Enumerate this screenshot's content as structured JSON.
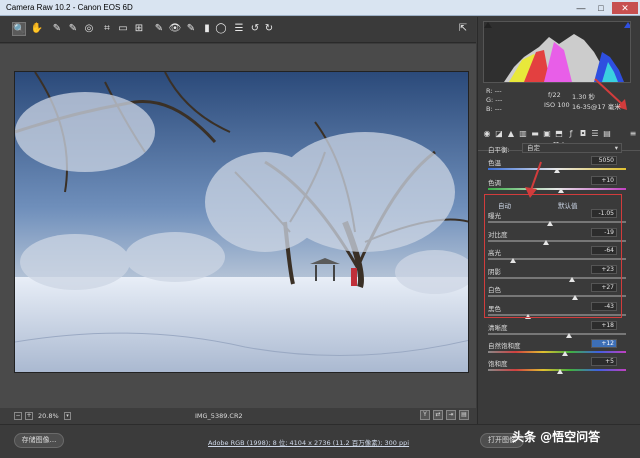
{
  "window": {
    "title": "Camera Raw 10.2  -  Canon EOS 6D",
    "minimize": "—",
    "maximize": "□",
    "close": "✕"
  },
  "photo": {
    "filename": "IMG_5389.CR2",
    "zoom": "20.8%"
  },
  "info": {
    "rgb_r": "R:  ---",
    "rgb_g": "G:  ---",
    "rgb_b": "B:  ---",
    "aperture": "f/22",
    "shutter": "1.30 秒",
    "iso": "ISO 100",
    "lens": "16-35@17 毫米"
  },
  "panel": {
    "title": "基本"
  },
  "white_balance": {
    "label": "白平衡:",
    "value": "自定"
  },
  "sliders_top": [
    {
      "label": "色温",
      "value": "5050",
      "pos": 0.5
    },
    {
      "label": "色调",
      "value": "+10",
      "pos": 0.53
    }
  ],
  "auto_links": {
    "auto": "自动",
    "default": "默认值"
  },
  "sliders_mid": [
    {
      "label": "曝光",
      "value": "-1.05",
      "pos": 0.45
    },
    {
      "label": "对比度",
      "value": "-19",
      "pos": 0.42
    },
    {
      "label": "高光",
      "value": "-64",
      "pos": 0.18
    },
    {
      "label": "阴影",
      "value": "+23",
      "pos": 0.61
    },
    {
      "label": "白色",
      "value": "+27",
      "pos": 0.63
    },
    {
      "label": "黑色",
      "value": "-43",
      "pos": 0.29
    }
  ],
  "sliders_bottom": [
    {
      "label": "清晰度",
      "value": "+18",
      "pos": 0.59
    },
    {
      "label": "自然饱和度",
      "value": "+12",
      "pos": 0.56,
      "highlight": true
    },
    {
      "label": "饱和度",
      "value": "+5",
      "pos": 0.52
    }
  ],
  "footer": {
    "save_button": "存储图像...",
    "workflow": "Adobe RGB (1998); 8 位; 4104 x 2736 (11.2 百万像素); 300 ppi",
    "open_button": "打开图像"
  },
  "watermark": "头条 @悟空问答",
  "colors": {
    "accent_red": "#d23c3c",
    "panel": "#3a3a3a",
    "highlight": "#3d6fb6"
  }
}
